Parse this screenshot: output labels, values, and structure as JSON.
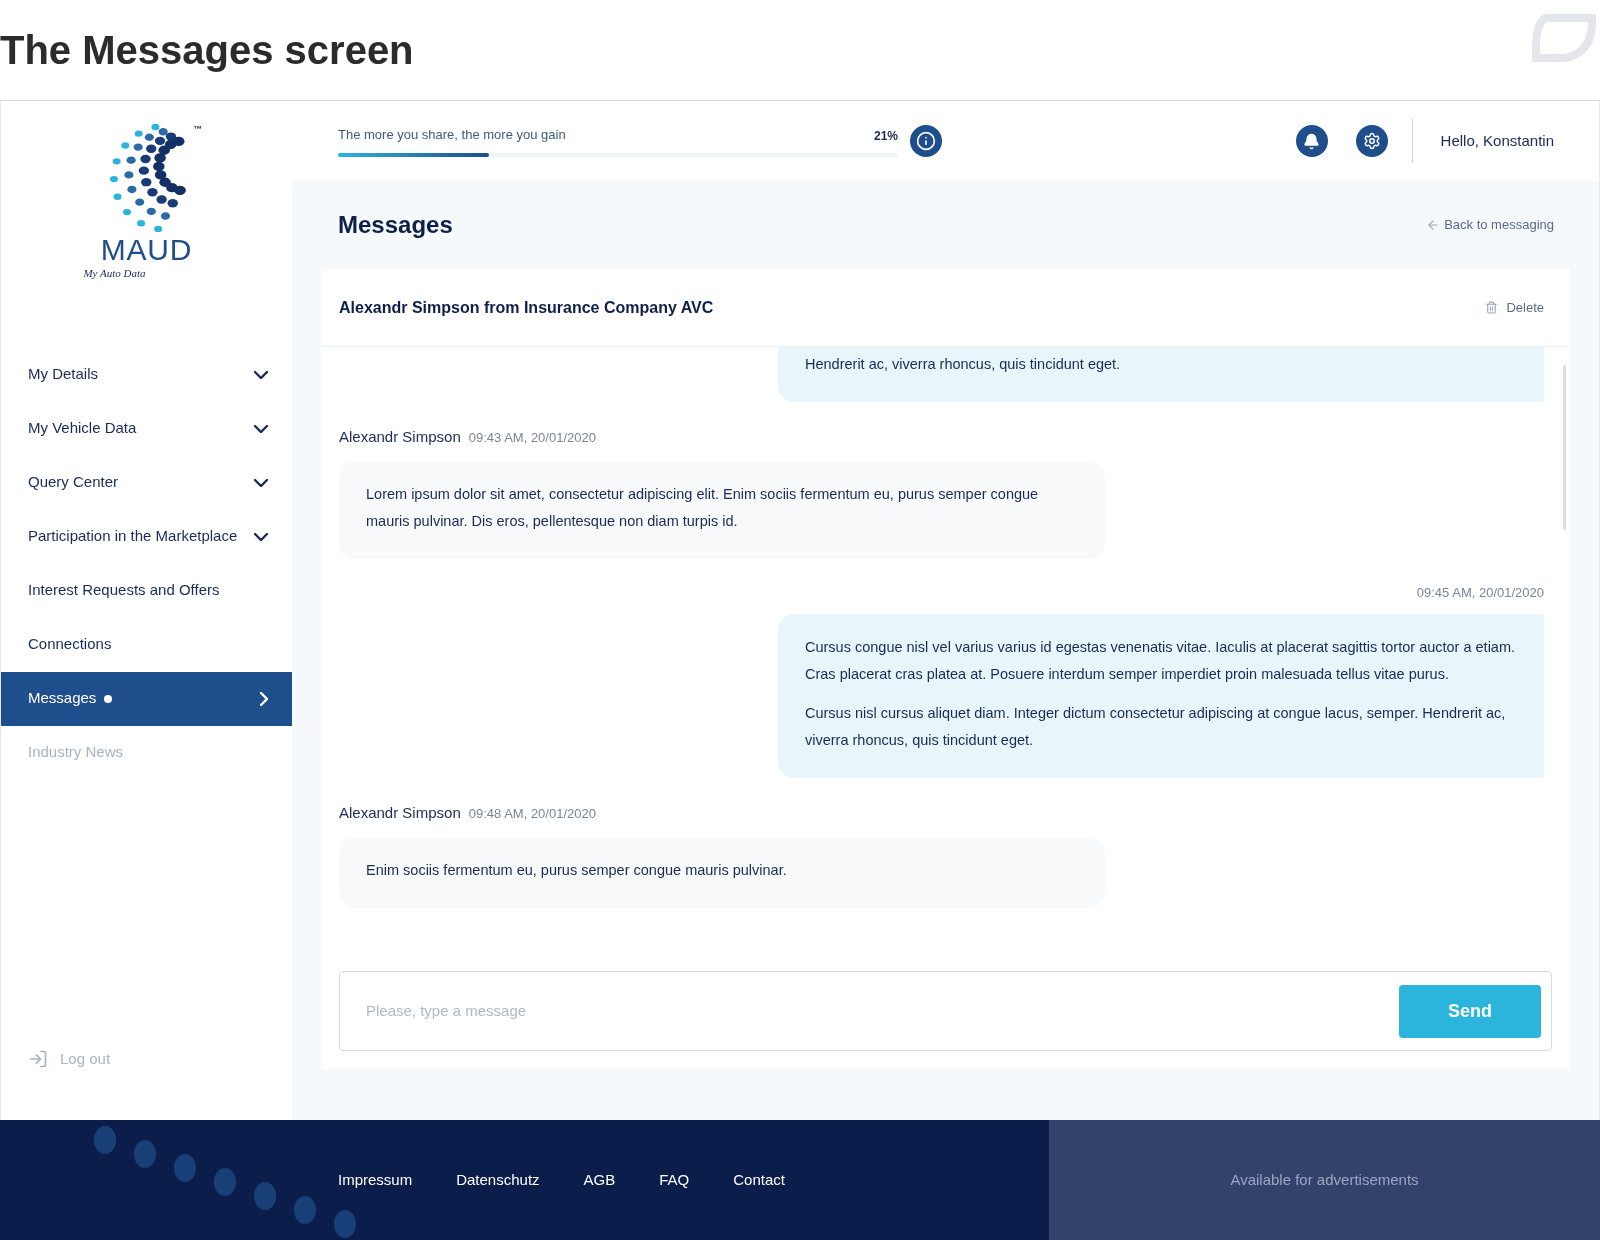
{
  "page_title": "The Messages screen",
  "logo": {
    "name": "MAUD",
    "tagline": "My Auto Data",
    "mark": "™"
  },
  "sidebar": {
    "items": [
      {
        "label": "My Details",
        "expandable": true,
        "selected": false,
        "disabled": false,
        "unread": false
      },
      {
        "label": "My Vehicle Data",
        "expandable": true,
        "selected": false,
        "disabled": false,
        "unread": false
      },
      {
        "label": "Query Center",
        "expandable": true,
        "selected": false,
        "disabled": false,
        "unread": false
      },
      {
        "label": "Participation in the Marketplace",
        "expandable": true,
        "selected": false,
        "disabled": false,
        "unread": false
      },
      {
        "label": "Interest Requests and Offers",
        "expandable": false,
        "selected": false,
        "disabled": false,
        "unread": false
      },
      {
        "label": "Connections",
        "expandable": false,
        "selected": false,
        "disabled": false,
        "unread": false
      },
      {
        "label": "Messages",
        "expandable": true,
        "selected": true,
        "disabled": false,
        "unread": true
      },
      {
        "label": "Industry News",
        "expandable": false,
        "selected": false,
        "disabled": true,
        "unread": false
      }
    ],
    "logout": "Log out"
  },
  "topbar": {
    "progress_label": "The more you share, the more you gain",
    "progress_reading": "21%",
    "level": 0.27,
    "greeting": "Hello, Konstantin"
  },
  "heading": "Messages",
  "back_link": "Back to messaging",
  "conversation": {
    "title": "Alexandr Simpson from Insurance Company AVC",
    "delete": "Delete",
    "messages": [
      {
        "kind": "outgoing",
        "paragraphs": [
          "Hendrerit ac, viverra rhoncus, quis tincidunt eget."
        ]
      },
      {
        "kind": "incoming",
        "sender": "Alexandr Simpson",
        "time": "09:43 AM, 20/01/2020",
        "paragraphs": [
          "Lorem ipsum dolor sit amet, consectetur adipiscing elit. Enim sociis fermentum eu, purus semper congue mauris pulvinar. Dis eros, pellentesque non diam turpis id."
        ]
      },
      {
        "kind": "outgoing",
        "time": "09:45 AM, 20/01/2020",
        "paragraphs": [
          "Cursus congue nisl vel varius varius id egestas venenatis vitae. Iaculis at placerat sagittis tortor auctor a etiam. Cras placerat cras platea at. Posuere interdum semper imperdiet proin malesuada tellus vitae purus.",
          "Cursus nisl cursus aliquet diam. Integer dictum consectetur adipiscing at congue lacus, semper. Hendrerit ac, viverra rhoncus, quis tincidunt eget."
        ]
      },
      {
        "kind": "incoming",
        "sender": "Alexandr Simpson",
        "time": "09:48 AM, 20/01/2020",
        "paragraphs": [
          "Enim sociis fermentum eu, purus semper congue mauris pulvinar."
        ]
      }
    ],
    "composer": {
      "placeholder": "Please, type a message",
      "send": "Send"
    }
  },
  "footer": {
    "links": [
      "Impressum",
      "Datenschutz",
      "AGB",
      "FAQ",
      "Contact"
    ],
    "ad": "Available for advertisements"
  }
}
